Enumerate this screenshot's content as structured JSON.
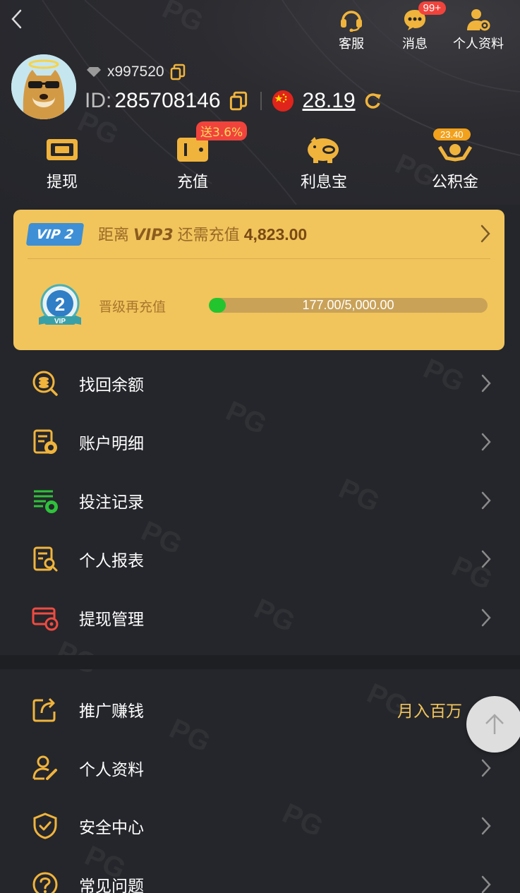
{
  "top_actions": [
    {
      "label": "客服",
      "icon": "headset-icon"
    },
    {
      "label": "消息",
      "icon": "chat-icon",
      "badge": "99+"
    },
    {
      "label": "个人资料",
      "icon": "profile-settings-icon"
    }
  ],
  "user": {
    "username": "x997520",
    "id_label": "ID:",
    "id_value": "285708146",
    "balance": "28.19",
    "avatar": "doge-sunglasses-avatar"
  },
  "quick_actions": [
    {
      "label": "提现",
      "icon": "withdraw-ticket-icon"
    },
    {
      "label": "充值",
      "icon": "wallet-icon",
      "badge": "送3.6%"
    },
    {
      "label": "利息宝",
      "icon": "piggy-bank-icon"
    },
    {
      "label": "公积金",
      "icon": "hands-coin-icon",
      "badge": "23.40"
    }
  ],
  "vip": {
    "level_tag": "VIP 2",
    "distance_text": "距离",
    "next_level": "VIP3",
    "need_text": "还需充值",
    "need_amount": "4,823.00",
    "medal_level": "2",
    "medal_text": "VIP",
    "upgrade_label": "晋级再充值",
    "progress_text": "177.00/5,000.00",
    "progress_fraction": 0.0354
  },
  "menu_group_1": [
    {
      "label": "找回余额",
      "icon": "recover-balance-icon"
    },
    {
      "label": "账户明细",
      "icon": "account-details-icon"
    },
    {
      "label": "投注记录",
      "icon": "bet-records-icon"
    },
    {
      "label": "个人报表",
      "icon": "personal-report-icon"
    },
    {
      "label": "提现管理",
      "icon": "withdraw-manage-icon"
    }
  ],
  "menu_group_2": [
    {
      "label": "推广赚钱",
      "icon": "share-icon",
      "extra": "月入百万"
    },
    {
      "label": "个人资料",
      "icon": "user-edit-icon"
    },
    {
      "label": "安全中心",
      "icon": "shield-check-icon"
    },
    {
      "label": "常见问题",
      "icon": "question-icon"
    }
  ],
  "colors": {
    "background": "#25262b",
    "gold": "#f1c55c",
    "accent_icon": "#f0b43c",
    "badge_red": "#f0433c",
    "vip_blue": "#3e8fd6",
    "progress_green": "#22c52e"
  }
}
